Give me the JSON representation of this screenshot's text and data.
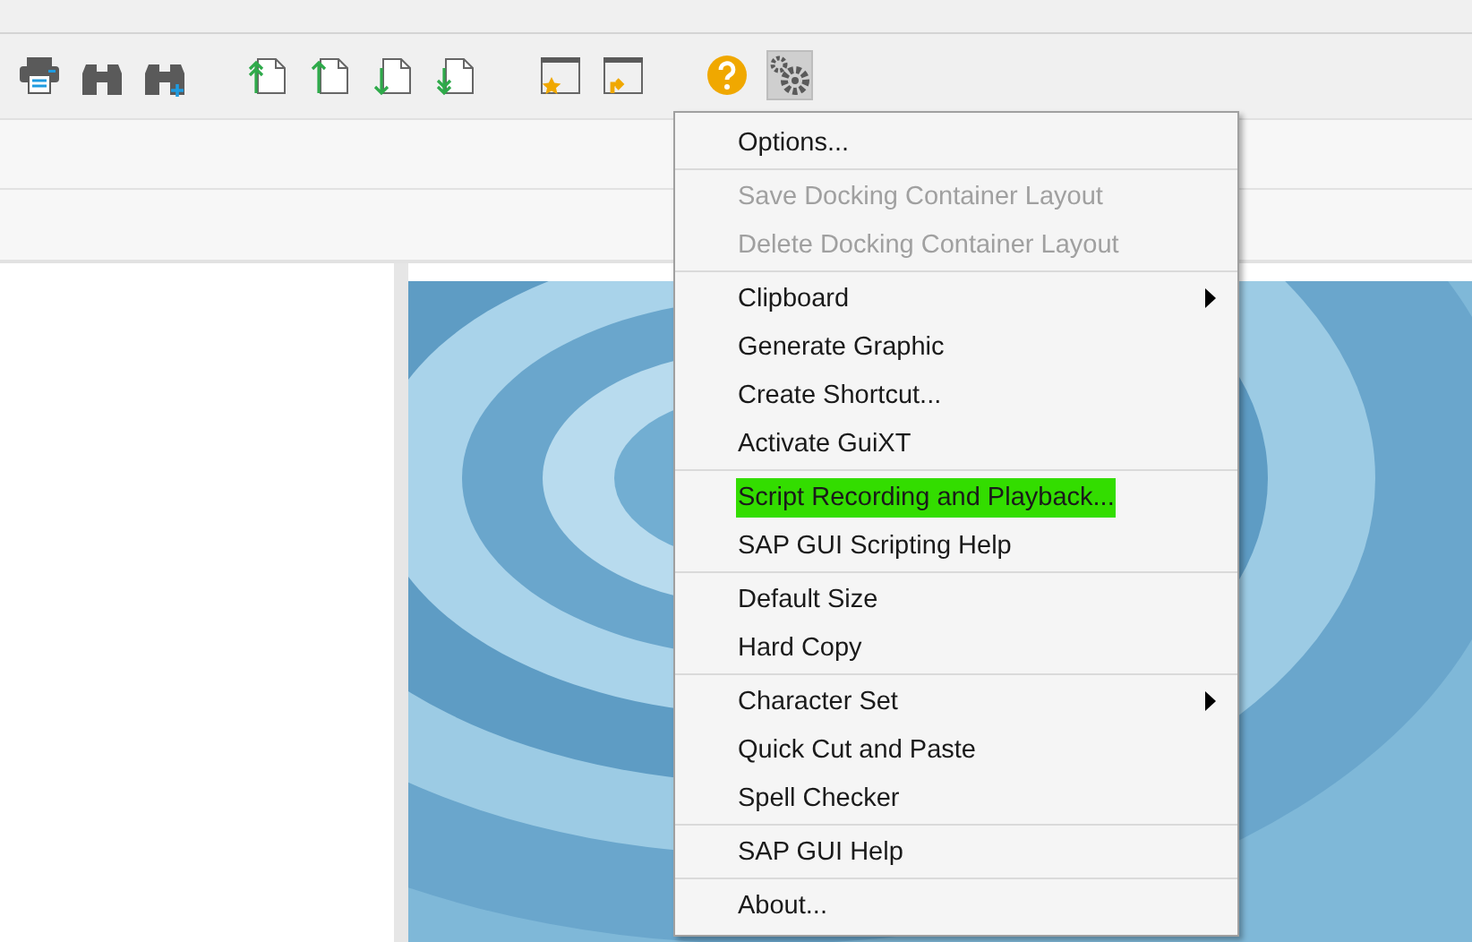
{
  "toolbar": {
    "items": [
      {
        "kind": "print"
      },
      {
        "kind": "find"
      },
      {
        "kind": "find-next"
      },
      {
        "kind": "first-page"
      },
      {
        "kind": "prev-page"
      },
      {
        "kind": "next-page"
      },
      {
        "kind": "last-page"
      },
      {
        "kind": "new-session"
      },
      {
        "kind": "shortcut"
      },
      {
        "kind": "help"
      },
      {
        "kind": "settings",
        "selected": true
      }
    ]
  },
  "menu": {
    "sections": [
      [
        {
          "label": "Options...",
          "disabled": false,
          "highlighted": false,
          "submenu": false
        }
      ],
      [
        {
          "label": "Save Docking Container Layout",
          "disabled": true,
          "highlighted": false,
          "submenu": false
        },
        {
          "label": "Delete Docking Container Layout",
          "disabled": true,
          "highlighted": false,
          "submenu": false
        }
      ],
      [
        {
          "label": "Clipboard",
          "disabled": false,
          "highlighted": false,
          "submenu": true
        },
        {
          "label": "Generate Graphic",
          "disabled": false,
          "highlighted": false,
          "submenu": false
        },
        {
          "label": "Create Shortcut...",
          "disabled": false,
          "highlighted": false,
          "submenu": false
        },
        {
          "label": "Activate GuiXT",
          "disabled": false,
          "highlighted": false,
          "submenu": false
        }
      ],
      [
        {
          "label": "Script Recording and Playback...",
          "disabled": false,
          "highlighted": true,
          "submenu": false
        },
        {
          "label": "SAP GUI Scripting Help",
          "disabled": false,
          "highlighted": false,
          "submenu": false
        }
      ],
      [
        {
          "label": "Default Size",
          "disabled": false,
          "highlighted": false,
          "submenu": false
        },
        {
          "label": "Hard Copy",
          "disabled": false,
          "highlighted": false,
          "submenu": false
        }
      ],
      [
        {
          "label": "Character Set",
          "disabled": false,
          "highlighted": false,
          "submenu": true
        },
        {
          "label": "Quick Cut and Paste",
          "disabled": false,
          "highlighted": false,
          "submenu": false
        },
        {
          "label": "Spell Checker",
          "disabled": false,
          "highlighted": false,
          "submenu": false
        }
      ],
      [
        {
          "label": "SAP GUI Help",
          "disabled": false,
          "highlighted": false,
          "submenu": false
        }
      ],
      [
        {
          "label": "About...",
          "disabled": false,
          "highlighted": false,
          "submenu": false
        }
      ]
    ]
  }
}
